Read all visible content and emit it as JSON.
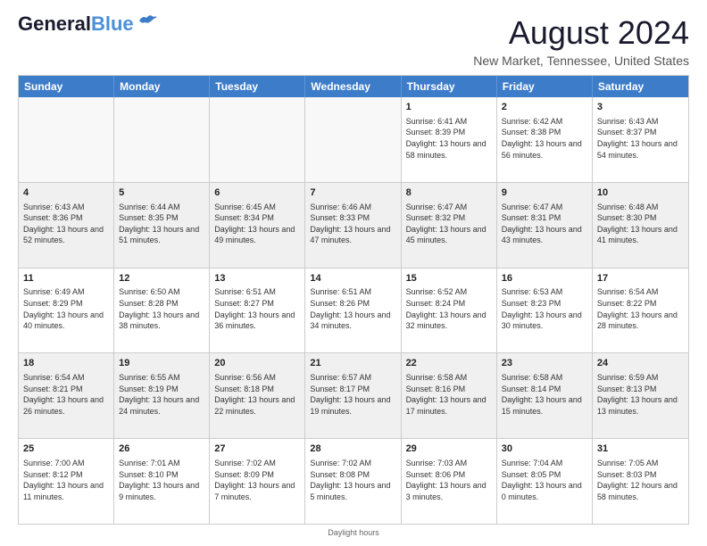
{
  "logo": {
    "line1": "General",
    "line2": "Blue"
  },
  "title": "August 2024",
  "subtitle": "New Market, Tennessee, United States",
  "days": [
    "Sunday",
    "Monday",
    "Tuesday",
    "Wednesday",
    "Thursday",
    "Friday",
    "Saturday"
  ],
  "weeks": [
    [
      {
        "day": "",
        "empty": true
      },
      {
        "day": "",
        "empty": true
      },
      {
        "day": "",
        "empty": true
      },
      {
        "day": "",
        "empty": true
      },
      {
        "day": "1",
        "sunrise": "Sunrise: 6:41 AM",
        "sunset": "Sunset: 8:39 PM",
        "daylight": "Daylight: 13 hours and 58 minutes.",
        "shaded": false
      },
      {
        "day": "2",
        "sunrise": "Sunrise: 6:42 AM",
        "sunset": "Sunset: 8:38 PM",
        "daylight": "Daylight: 13 hours and 56 minutes.",
        "shaded": false
      },
      {
        "day": "3",
        "sunrise": "Sunrise: 6:43 AM",
        "sunset": "Sunset: 8:37 PM",
        "daylight": "Daylight: 13 hours and 54 minutes.",
        "shaded": false
      }
    ],
    [
      {
        "day": "4",
        "sunrise": "Sunrise: 6:43 AM",
        "sunset": "Sunset: 8:36 PM",
        "daylight": "Daylight: 13 hours and 52 minutes.",
        "shaded": true
      },
      {
        "day": "5",
        "sunrise": "Sunrise: 6:44 AM",
        "sunset": "Sunset: 8:35 PM",
        "daylight": "Daylight: 13 hours and 51 minutes.",
        "shaded": true
      },
      {
        "day": "6",
        "sunrise": "Sunrise: 6:45 AM",
        "sunset": "Sunset: 8:34 PM",
        "daylight": "Daylight: 13 hours and 49 minutes.",
        "shaded": true
      },
      {
        "day": "7",
        "sunrise": "Sunrise: 6:46 AM",
        "sunset": "Sunset: 8:33 PM",
        "daylight": "Daylight: 13 hours and 47 minutes.",
        "shaded": true
      },
      {
        "day": "8",
        "sunrise": "Sunrise: 6:47 AM",
        "sunset": "Sunset: 8:32 PM",
        "daylight": "Daylight: 13 hours and 45 minutes.",
        "shaded": true
      },
      {
        "day": "9",
        "sunrise": "Sunrise: 6:47 AM",
        "sunset": "Sunset: 8:31 PM",
        "daylight": "Daylight: 13 hours and 43 minutes.",
        "shaded": true
      },
      {
        "day": "10",
        "sunrise": "Sunrise: 6:48 AM",
        "sunset": "Sunset: 8:30 PM",
        "daylight": "Daylight: 13 hours and 41 minutes.",
        "shaded": true
      }
    ],
    [
      {
        "day": "11",
        "sunrise": "Sunrise: 6:49 AM",
        "sunset": "Sunset: 8:29 PM",
        "daylight": "Daylight: 13 hours and 40 minutes.",
        "shaded": false
      },
      {
        "day": "12",
        "sunrise": "Sunrise: 6:50 AM",
        "sunset": "Sunset: 8:28 PM",
        "daylight": "Daylight: 13 hours and 38 minutes.",
        "shaded": false
      },
      {
        "day": "13",
        "sunrise": "Sunrise: 6:51 AM",
        "sunset": "Sunset: 8:27 PM",
        "daylight": "Daylight: 13 hours and 36 minutes.",
        "shaded": false
      },
      {
        "day": "14",
        "sunrise": "Sunrise: 6:51 AM",
        "sunset": "Sunset: 8:26 PM",
        "daylight": "Daylight: 13 hours and 34 minutes.",
        "shaded": false
      },
      {
        "day": "15",
        "sunrise": "Sunrise: 6:52 AM",
        "sunset": "Sunset: 8:24 PM",
        "daylight": "Daylight: 13 hours and 32 minutes.",
        "shaded": false
      },
      {
        "day": "16",
        "sunrise": "Sunrise: 6:53 AM",
        "sunset": "Sunset: 8:23 PM",
        "daylight": "Daylight: 13 hours and 30 minutes.",
        "shaded": false
      },
      {
        "day": "17",
        "sunrise": "Sunrise: 6:54 AM",
        "sunset": "Sunset: 8:22 PM",
        "daylight": "Daylight: 13 hours and 28 minutes.",
        "shaded": false
      }
    ],
    [
      {
        "day": "18",
        "sunrise": "Sunrise: 6:54 AM",
        "sunset": "Sunset: 8:21 PM",
        "daylight": "Daylight: 13 hours and 26 minutes.",
        "shaded": true
      },
      {
        "day": "19",
        "sunrise": "Sunrise: 6:55 AM",
        "sunset": "Sunset: 8:19 PM",
        "daylight": "Daylight: 13 hours and 24 minutes.",
        "shaded": true
      },
      {
        "day": "20",
        "sunrise": "Sunrise: 6:56 AM",
        "sunset": "Sunset: 8:18 PM",
        "daylight": "Daylight: 13 hours and 22 minutes.",
        "shaded": true
      },
      {
        "day": "21",
        "sunrise": "Sunrise: 6:57 AM",
        "sunset": "Sunset: 8:17 PM",
        "daylight": "Daylight: 13 hours and 19 minutes.",
        "shaded": true
      },
      {
        "day": "22",
        "sunrise": "Sunrise: 6:58 AM",
        "sunset": "Sunset: 8:16 PM",
        "daylight": "Daylight: 13 hours and 17 minutes.",
        "shaded": true
      },
      {
        "day": "23",
        "sunrise": "Sunrise: 6:58 AM",
        "sunset": "Sunset: 8:14 PM",
        "daylight": "Daylight: 13 hours and 15 minutes.",
        "shaded": true
      },
      {
        "day": "24",
        "sunrise": "Sunrise: 6:59 AM",
        "sunset": "Sunset: 8:13 PM",
        "daylight": "Daylight: 13 hours and 13 minutes.",
        "shaded": true
      }
    ],
    [
      {
        "day": "25",
        "sunrise": "Sunrise: 7:00 AM",
        "sunset": "Sunset: 8:12 PM",
        "daylight": "Daylight: 13 hours and 11 minutes.",
        "shaded": false
      },
      {
        "day": "26",
        "sunrise": "Sunrise: 7:01 AM",
        "sunset": "Sunset: 8:10 PM",
        "daylight": "Daylight: 13 hours and 9 minutes.",
        "shaded": false
      },
      {
        "day": "27",
        "sunrise": "Sunrise: 7:02 AM",
        "sunset": "Sunset: 8:09 PM",
        "daylight": "Daylight: 13 hours and 7 minutes.",
        "shaded": false
      },
      {
        "day": "28",
        "sunrise": "Sunrise: 7:02 AM",
        "sunset": "Sunset: 8:08 PM",
        "daylight": "Daylight: 13 hours and 5 minutes.",
        "shaded": false
      },
      {
        "day": "29",
        "sunrise": "Sunrise: 7:03 AM",
        "sunset": "Sunset: 8:06 PM",
        "daylight": "Daylight: 13 hours and 3 minutes.",
        "shaded": false
      },
      {
        "day": "30",
        "sunrise": "Sunrise: 7:04 AM",
        "sunset": "Sunset: 8:05 PM",
        "daylight": "Daylight: 13 hours and 0 minutes.",
        "shaded": false
      },
      {
        "day": "31",
        "sunrise": "Sunrise: 7:05 AM",
        "sunset": "Sunset: 8:03 PM",
        "daylight": "Daylight: 12 hours and 58 minutes.",
        "shaded": false
      }
    ]
  ],
  "footer": "Daylight hours"
}
